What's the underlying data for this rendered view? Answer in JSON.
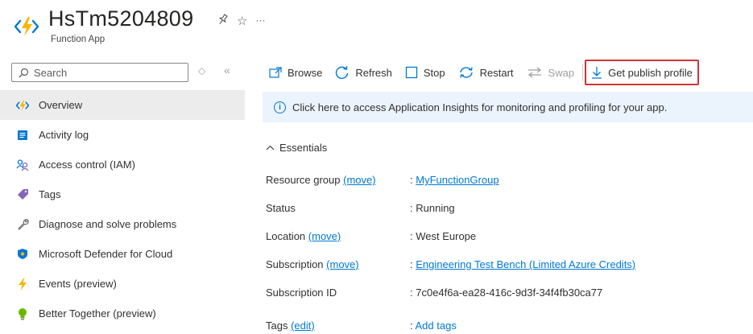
{
  "header": {
    "title": "HsTm5204809",
    "subtitle": "Function App",
    "pin_glyph": "☆",
    "more_glyph": "···"
  },
  "search": {
    "placeholder": "Search",
    "collapse_glyph": "«",
    "sort_glyph": "◇"
  },
  "sidebar": {
    "items": [
      {
        "label": "Overview",
        "icon": "function-app-icon",
        "active": true
      },
      {
        "label": "Activity log",
        "icon": "activity-log-icon"
      },
      {
        "label": "Access control (IAM)",
        "icon": "iam-icon"
      },
      {
        "label": "Tags",
        "icon": "tag-icon"
      },
      {
        "label": "Diagnose and solve problems",
        "icon": "wrench-icon"
      },
      {
        "label": "Microsoft Defender for Cloud",
        "icon": "shield-icon"
      },
      {
        "label": "Events (preview)",
        "icon": "lightning-icon"
      },
      {
        "label": "Better Together (preview)",
        "icon": "lightbulb-icon"
      }
    ]
  },
  "toolbar": {
    "browse": "Browse",
    "refresh": "Refresh",
    "stop": "Stop",
    "restart": "Restart",
    "swap": "Swap",
    "get_publish_profile": "Get publish profile"
  },
  "banner": {
    "text": "Click here to access Application Insights for monitoring and profiling for your app."
  },
  "essentials": {
    "header": "Essentials",
    "rows": [
      {
        "label": "Resource group",
        "label_link": "(move)",
        "value": "MyFunctionGroup",
        "value_link": true
      },
      {
        "label": "Status",
        "value": "Running"
      },
      {
        "label": "Location",
        "label_link": "(move)",
        "value": "West Europe"
      },
      {
        "label": "Subscription",
        "label_link": "(move)",
        "value": "Engineering Test Bench (Limited Azure Credits)",
        "value_link": true
      },
      {
        "label": "Subscription ID",
        "value": "7c0e4f6a-ea28-416c-9d3f-34f4fb30ca77"
      }
    ],
    "tags": {
      "label": "Tags",
      "label_link": "(edit)",
      "value": "Add tags"
    }
  },
  "colors": {
    "accent": "#0078d4",
    "highlight_border": "#d13438",
    "banner_bg": "#ebf3fc",
    "nav_active_bg": "#ececec"
  }
}
